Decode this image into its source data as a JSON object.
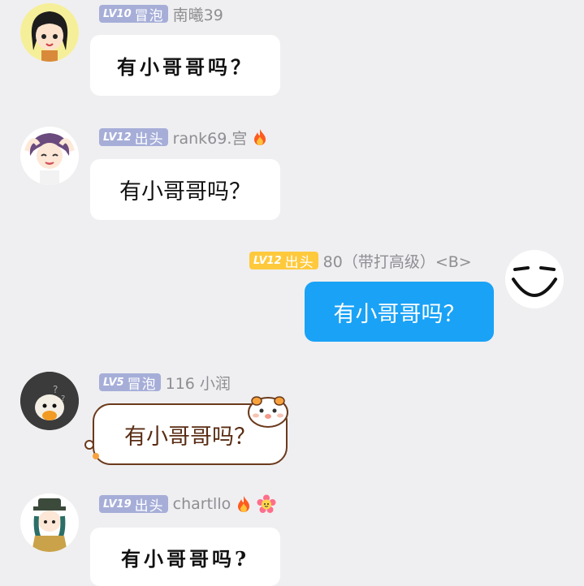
{
  "messages": [
    {
      "level": "LV10",
      "rank": "冒泡",
      "username": "南曦39",
      "text": "有小哥哥吗？",
      "badge_color": "#a6aed8"
    },
    {
      "level": "LV12",
      "rank": "出头",
      "username": "rank69.宫",
      "text": "有小哥哥吗？",
      "badge_color": "#a6aed8",
      "icons": [
        "fire-icon"
      ]
    },
    {
      "level": "LV12",
      "rank": "出头",
      "username": "80（带打高级）<B>",
      "text": "有小哥哥吗？",
      "badge_color": "#ffc93c",
      "bubble_color": "#1aa2f6"
    },
    {
      "level": "LV5",
      "rank": "冒泡",
      "username": "116 小润",
      "text": "有小哥哥吗？",
      "badge_color": "#a6aed8"
    },
    {
      "level": "LV19",
      "rank": "出头",
      "username": "chartllo",
      "text": "有小哥哥吗?",
      "badge_color": "#a6aed8",
      "icons": [
        "fire-icon",
        "flower-icon"
      ]
    }
  ]
}
